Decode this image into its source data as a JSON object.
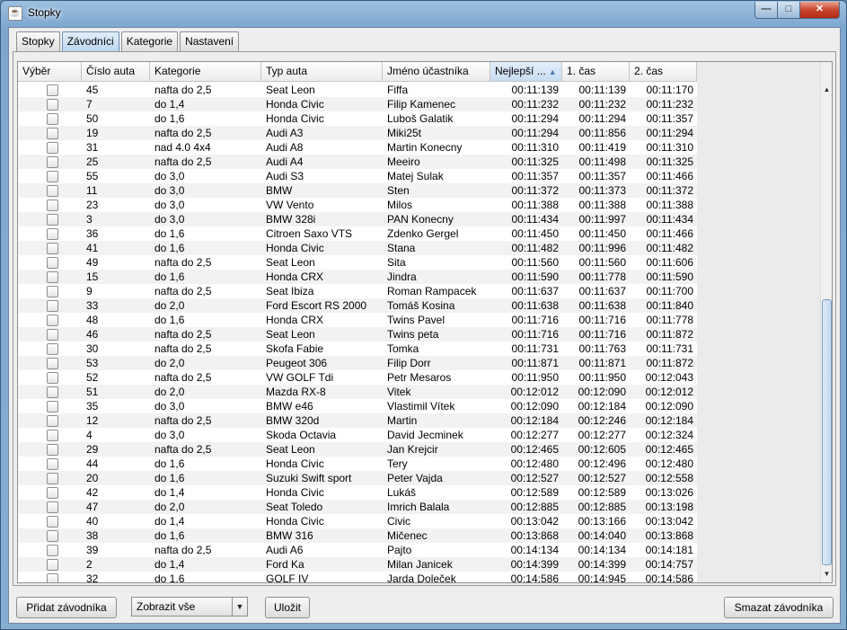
{
  "window": {
    "title": "Stopky",
    "minimize": "—",
    "maximize": "□",
    "close": "✕"
  },
  "tabs": [
    {
      "label": "Stopky"
    },
    {
      "label": "Závodníci"
    },
    {
      "label": "Kategorie"
    },
    {
      "label": "Nastavení"
    }
  ],
  "active_tab": 1,
  "table": {
    "columns": [
      "Výběr",
      "Číslo auta",
      "Kategorie",
      "Typ auta",
      "Jméno účastníka",
      "Nejlepší ...",
      "1. čas",
      "2. čas"
    ],
    "sorted_column": 5,
    "sort_direction": "ascending",
    "rows": [
      [
        "45",
        "nafta do 2,5",
        "Seat Leon",
        "Fiffa",
        "00:11:139",
        "00:11:139",
        "00:11:170"
      ],
      [
        "7",
        "do 1,4",
        "Honda Civic",
        "Filip Kamenec",
        "00:11:232",
        "00:11:232",
        "00:11:232"
      ],
      [
        "50",
        "do 1,6",
        "Honda Civic",
        "Luboš Galatik",
        "00:11:294",
        "00:11:294",
        "00:11:357"
      ],
      [
        "19",
        "nafta do 2,5",
        "Audi A3",
        "Miki25t",
        "00:11:294",
        "00:11:856",
        "00:11:294"
      ],
      [
        "31",
        "nad 4.0 4x4",
        "Audi A8",
        "Martin Konecny",
        "00:11:310",
        "00:11:419",
        "00:11:310"
      ],
      [
        "25",
        "nafta do 2,5",
        "Audi A4",
        "Meeiro",
        "00:11:325",
        "00:11:498",
        "00:11:325"
      ],
      [
        "55",
        "do 3,0",
        "Audi S3",
        "Matej Sulak",
        "00:11:357",
        "00:11:357",
        "00:11:466"
      ],
      [
        "11",
        "do 3,0",
        "BMW",
        "Sten",
        "00:11:372",
        "00:11:373",
        "00:11:372"
      ],
      [
        "23",
        "do 3,0",
        "VW Vento",
        "Milos",
        "00:11:388",
        "00:11:388",
        "00:11:388"
      ],
      [
        "3",
        "do 3,0",
        "BMW 328i",
        "PAN Konecny",
        "00:11:434",
        "00:11:997",
        "00:11:434"
      ],
      [
        "36",
        "do 1,6",
        "Citroen Saxo VTS",
        "Zdenko Gergel",
        "00:11:450",
        "00:11:450",
        "00:11:466"
      ],
      [
        "41",
        "do 1,6",
        "Honda Civic",
        "Stana",
        "00:11:482",
        "00:11:996",
        "00:11:482"
      ],
      [
        "49",
        "nafta do 2,5",
        "Seat Leon",
        "Sita",
        "00:11:560",
        "00:11:560",
        "00:11:606"
      ],
      [
        "15",
        "do 1,6",
        "Honda CRX",
        "Jindra",
        "00:11:590",
        "00:11:778",
        "00:11:590"
      ],
      [
        "9",
        "nafta do 2,5",
        "Seat Ibiza",
        "Roman Rampacek",
        "00:11:637",
        "00:11:637",
        "00:11:700"
      ],
      [
        "33",
        "do 2,0",
        "Ford Escort RS 2000",
        "Tomáš Kosina",
        "00:11:638",
        "00:11:638",
        "00:11:840"
      ],
      [
        "48",
        "do 1,6",
        "Honda CRX",
        "Twins Pavel",
        "00:11:716",
        "00:11:716",
        "00:11:778"
      ],
      [
        "46",
        "nafta do 2,5",
        "Seat Leon",
        "Twins peta",
        "00:11:716",
        "00:11:716",
        "00:11:872"
      ],
      [
        "30",
        "nafta do 2,5",
        "Skofa Fabie",
        "Tomka",
        "00:11:731",
        "00:11:763",
        "00:11:731"
      ],
      [
        "53",
        "do 2,0",
        "Peugeot 306",
        "Filip Dorr",
        "00:11:871",
        "00:11:871",
        "00:11:872"
      ],
      [
        "52",
        "nafta do 2,5",
        "VW GOLF Tdi",
        "Petr Mesaros",
        "00:11:950",
        "00:11:950",
        "00:12:043"
      ],
      [
        "51",
        "do 2,0",
        "Mazda RX-8",
        "Vitek",
        "00:12:012",
        "00:12:090",
        "00:12:012"
      ],
      [
        "35",
        "do 3,0",
        "BMW e46",
        "Vlastimil Vítek",
        "00:12:090",
        "00:12:184",
        "00:12:090"
      ],
      [
        "12",
        "nafta do 2,5",
        "BMW 320d",
        "Martin",
        "00:12:184",
        "00:12:246",
        "00:12:184"
      ],
      [
        "4",
        "do 3,0",
        "Skoda Octavia",
        "David Jecminek",
        "00:12:277",
        "00:12:277",
        "00:12:324"
      ],
      [
        "29",
        "nafta do 2,5",
        "Seat Leon",
        "Jan Krejcir",
        "00:12:465",
        "00:12:605",
        "00:12:465"
      ],
      [
        "44",
        "do 1,6",
        "Honda Civic",
        "Tery",
        "00:12:480",
        "00:12:496",
        "00:12:480"
      ],
      [
        "20",
        "do 1,6",
        "Suzuki Swift sport",
        "Peter Vajda",
        "00:12:527",
        "00:12:527",
        "00:12:558"
      ],
      [
        "42",
        "do 1,4",
        "Honda Civic",
        "Lukáš",
        "00:12:589",
        "00:12:589",
        "00:13:026"
      ],
      [
        "47",
        "do 2,0",
        "Seat Toledo",
        "Imrich Balala",
        "00:12:885",
        "00:12:885",
        "00:13:198"
      ],
      [
        "40",
        "do 1,4",
        "Honda Civic",
        "Civic",
        "00:13:042",
        "00:13:166",
        "00:13:042"
      ],
      [
        "38",
        "do 1,6",
        "BMW 316",
        "Mičenec",
        "00:13:868",
        "00:14:040",
        "00:13:868"
      ],
      [
        "39",
        "nafta do 2,5",
        "Audi A6",
        "Pajto",
        "00:14:134",
        "00:14:134",
        "00:14:181"
      ],
      [
        "2",
        "do 1,4",
        "Ford Ka",
        "Milan Janicek",
        "00:14:399",
        "00:14:399",
        "00:14:757"
      ],
      [
        "32",
        "do 1,6",
        "GOLF IV",
        "Jarda Doleček",
        "00:14:586",
        "00:14:945",
        "00:14:586"
      ]
    ]
  },
  "bottom": {
    "add_button": "Přidat závodníka",
    "filter_select": "Zobrazit vše",
    "save_button": "Uložit",
    "delete_button": "Smazat závodníka"
  },
  "colors": {
    "selected_tab": "#c7dcf1",
    "sorted_header": "#c7dcf1",
    "close_button": "#c8452c"
  }
}
